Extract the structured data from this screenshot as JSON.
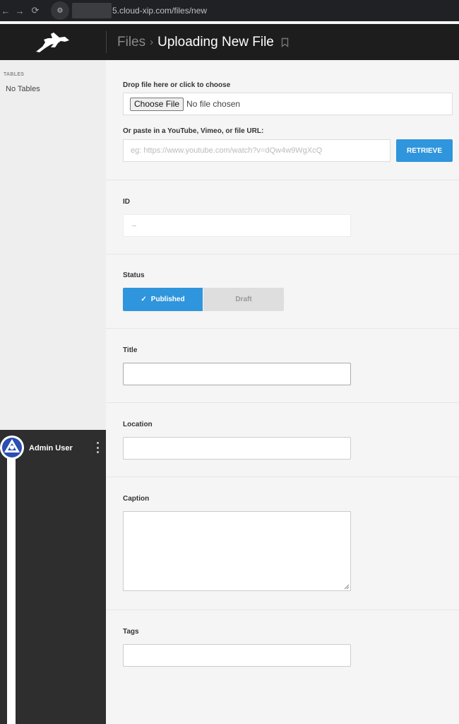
{
  "browser": {
    "url": "5.cloud-xip.com/files/new",
    "back_icon": "←",
    "forward_icon": "→",
    "reload_icon": "⟳",
    "site_icon": "⚙"
  },
  "header": {
    "breadcrumb_parent": "Files",
    "breadcrumb_separator": "›",
    "breadcrumb_current": "Uploading New File"
  },
  "sidebar": {
    "heading": "TABLES",
    "empty_text": "No Tables"
  },
  "user": {
    "name": "Admin User"
  },
  "form": {
    "drop_label": "Drop file here or click to choose",
    "choose_button": "Choose File",
    "file_chosen_text": "No file chosen",
    "paste_label": "Or paste in a YouTube, Vimeo, or file URL:",
    "url_placeholder": "eg: https://www.youtube.com/watch?v=dQw4w9WgXcQ",
    "retrieve_button": "RETRIEVE",
    "id_label": "ID",
    "id_value": "--",
    "status_label": "Status",
    "status_published": "Published",
    "status_draft": "Draft",
    "status_selected": "Published",
    "title_label": "Title",
    "location_label": "Location",
    "caption_label": "Caption",
    "tags_label": "Tags"
  },
  "colors": {
    "accent": "#2f95dc",
    "header_bg": "#1d1d1d",
    "sidebar_bg": "#eeeeee",
    "user_panel_bg": "#2e2e2e"
  }
}
